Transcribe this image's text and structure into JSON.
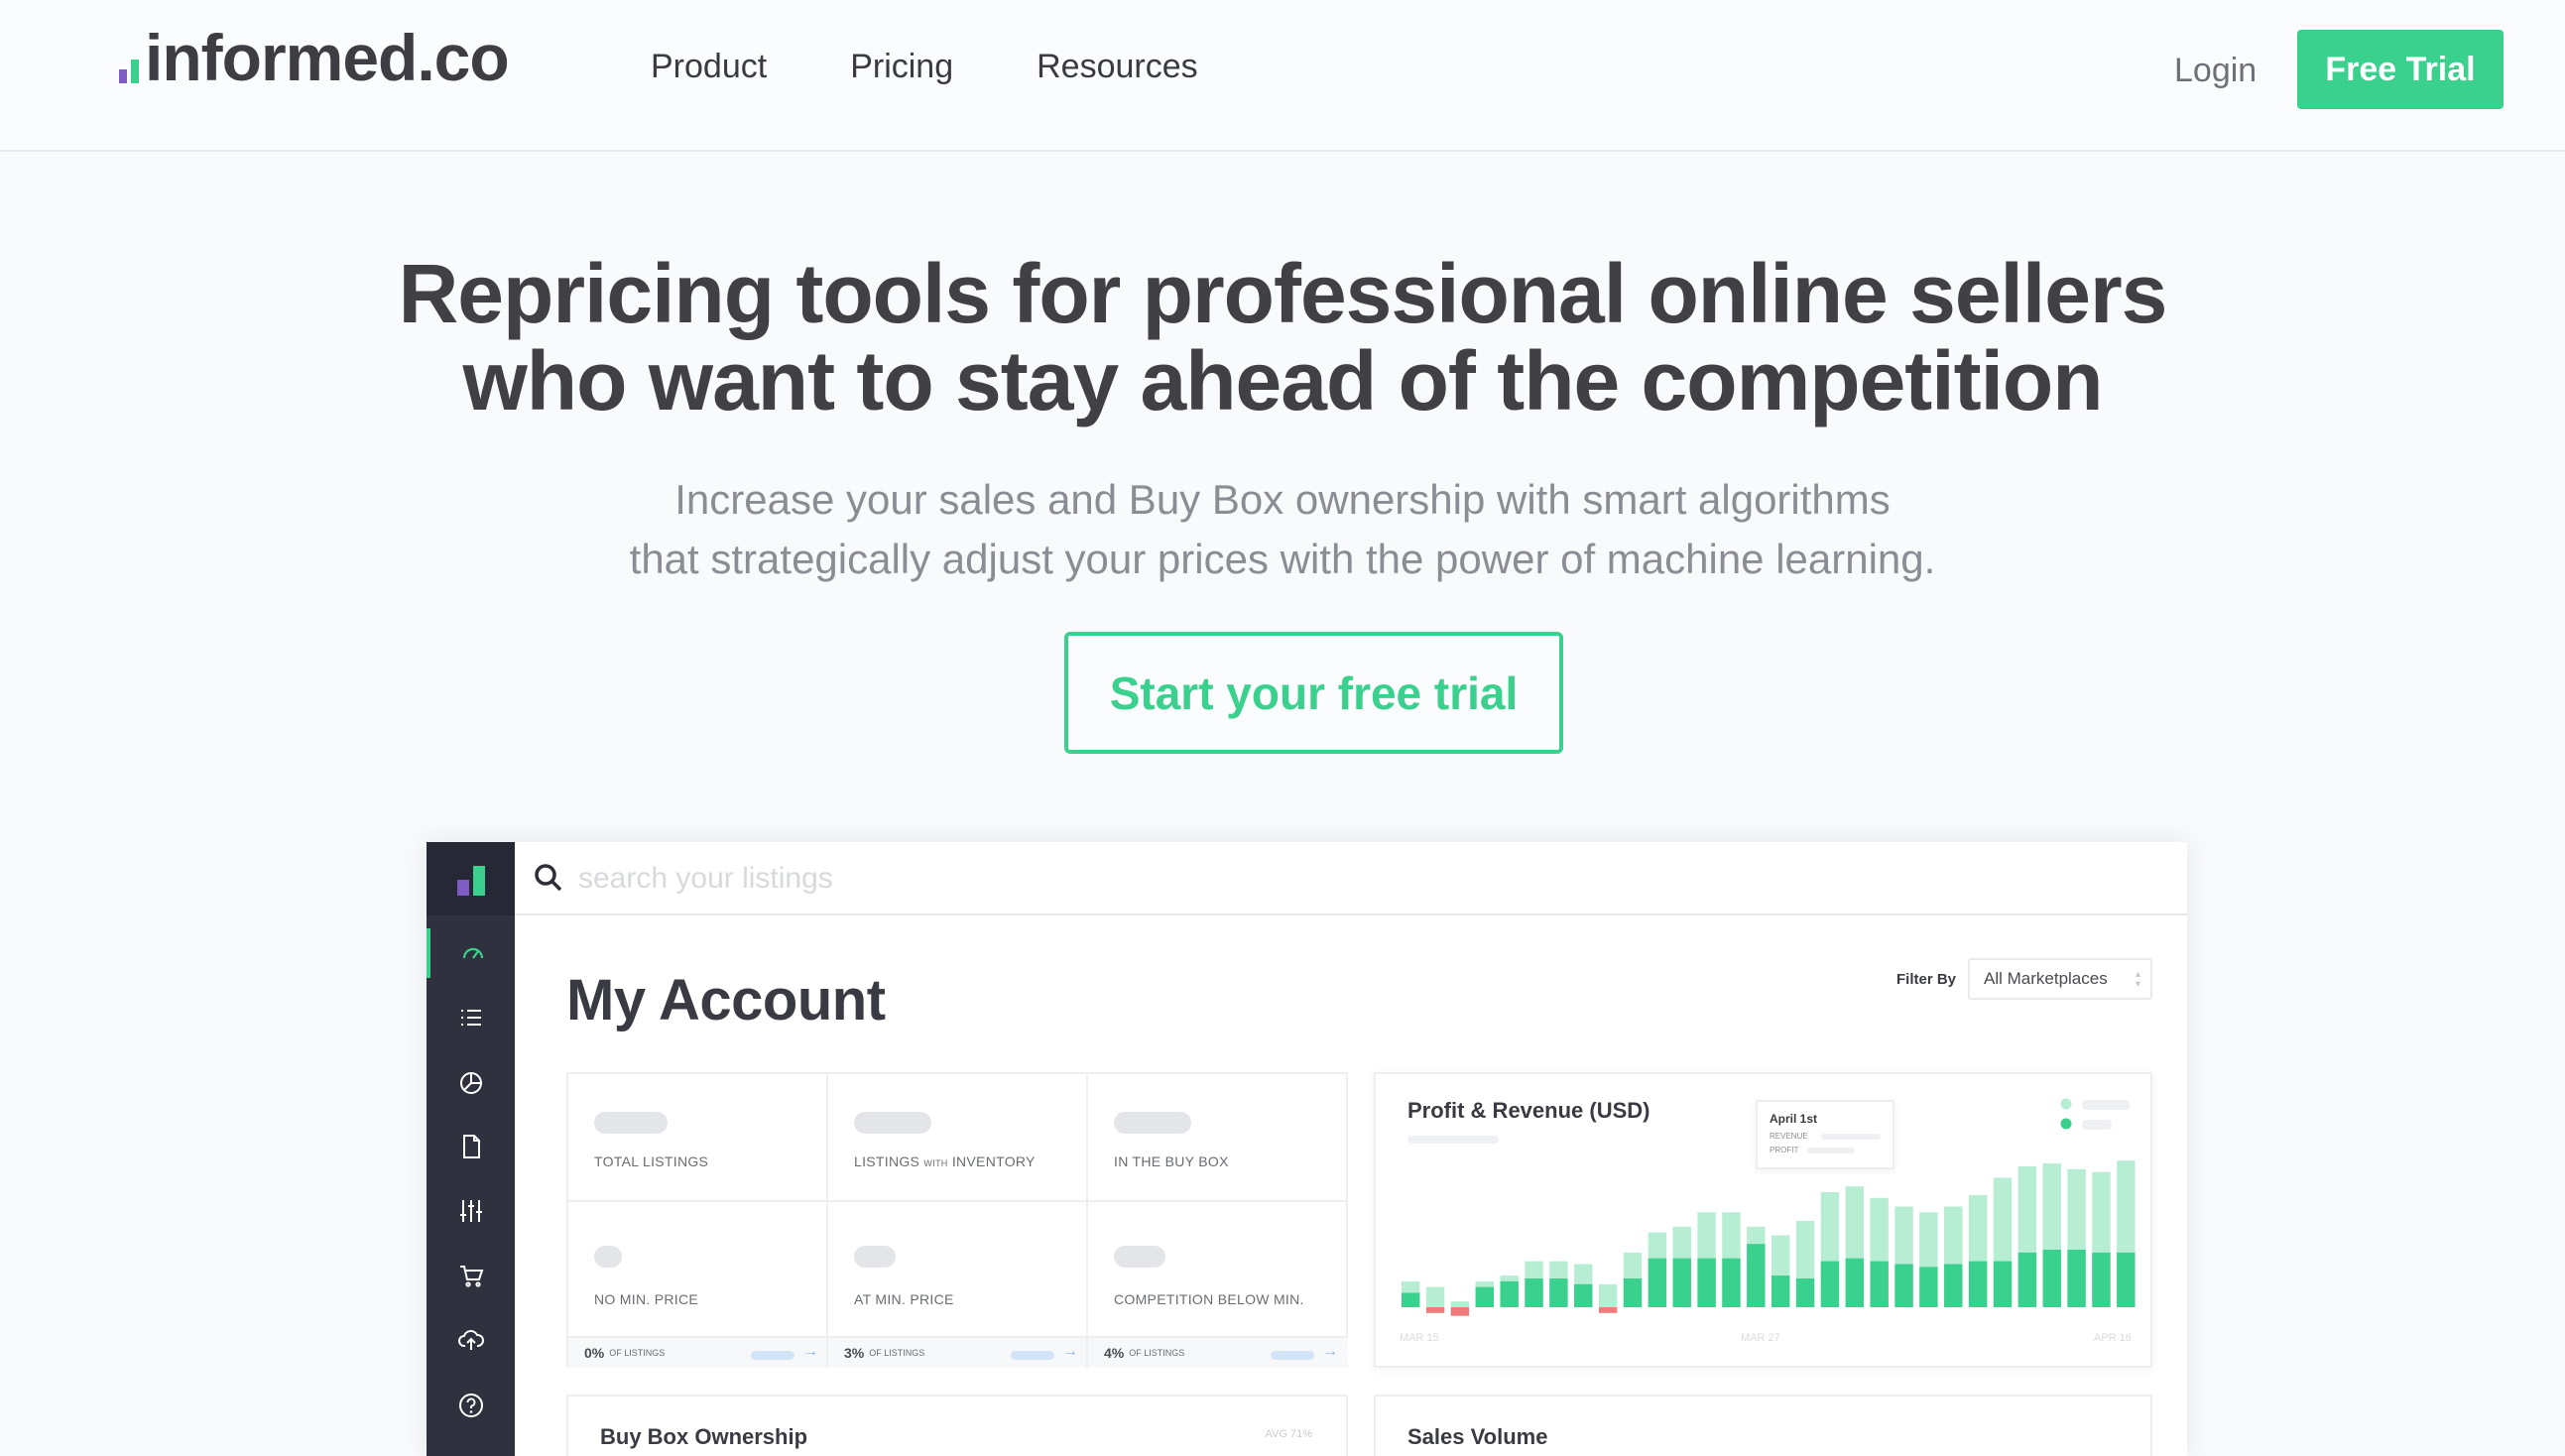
{
  "nav": {
    "logo": "informed.co",
    "links": [
      "Product",
      "Pricing",
      "Resources"
    ],
    "login": "Login",
    "trial": "Free Trial"
  },
  "hero": {
    "title_line1": "Repricing tools for professional online sellers",
    "title_line2": "who want to stay ahead of the competition",
    "sub_line1": "Increase your sales and Buy Box ownership with smart algorithms",
    "sub_line2": "that strategically adjust your prices with the power of machine learning.",
    "cta": "Start your free trial"
  },
  "app": {
    "search_placeholder": "search your listings",
    "page_title": "My Account",
    "filter_label": "Filter By",
    "filter_value": "All Marketplaces",
    "sidebar_icons": [
      "dashboard-icon",
      "list-icon",
      "pie-chart-icon",
      "document-icon",
      "sliders-icon",
      "cart-icon",
      "cloud-upload-icon",
      "help-icon"
    ],
    "top_icons": [
      "help-icon",
      "bell-icon",
      "user-icon"
    ],
    "stats": [
      {
        "label": "TOTAL LISTINGS"
      },
      {
        "label_pre": "LISTINGS",
        "label_small": "WITH",
        "label_post": "INVENTORY"
      },
      {
        "label": "IN THE BUY BOX"
      },
      {
        "label": "NO MIN. PRICE",
        "foot_pct": "0%",
        "foot_text": "OF LISTINGS"
      },
      {
        "label": "AT MIN. PRICE",
        "foot_pct": "3%",
        "foot_text": "OF LISTINGS"
      },
      {
        "label": "COMPETITION BELOW MIN.",
        "foot_pct": "4%",
        "foot_text": "OF LISTINGS"
      }
    ],
    "profit_card": {
      "title": "Profit & Revenue (USD)",
      "tooltip_date": "April 1st",
      "tooltip_row1": "REVENUE",
      "tooltip_row2": "PROFIT",
      "x_labels": [
        "MAR 15",
        "MAR 27",
        "APR 16"
      ]
    },
    "buybox_card": {
      "title": "Buy Box Ownership",
      "avg": "AVG 71%"
    },
    "sales_card": {
      "title": "Sales Volume"
    }
  },
  "colors": {
    "accent": "#3ad08d",
    "accent_light": "#b7edd3",
    "negative": "#f07b7b",
    "sidebar": "#2f323e",
    "logo_purple": "#7f5bc6"
  },
  "chart_data": {
    "type": "bar",
    "series": [
      {
        "values": [
          18,
          14,
          4,
          18,
          22,
          32,
          32,
          30,
          16,
          38,
          52,
          56,
          66,
          66,
          56,
          50,
          60,
          80,
          84,
          76,
          70,
          66,
          70,
          78,
          90,
          98,
          100,
          96,
          94,
          102
        ]
      },
      {
        "values": [
          10,
          -4,
          -6,
          14,
          18,
          20,
          20,
          16,
          -4,
          20,
          34,
          34,
          34,
          34,
          44,
          22,
          20,
          32,
          34,
          32,
          30,
          28,
          30,
          32,
          32,
          38,
          40,
          40,
          38,
          38
        ]
      }
    ]
  }
}
